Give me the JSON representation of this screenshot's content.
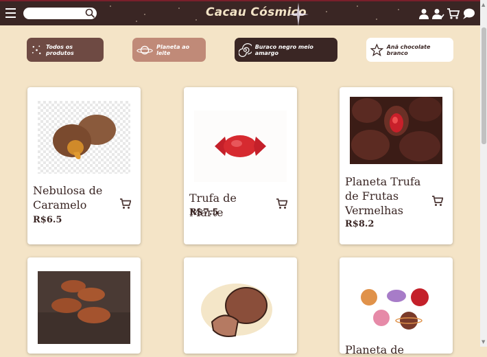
{
  "header": {
    "brand": "Cacau Cósmico",
    "search": {
      "placeholder": "",
      "value": ""
    }
  },
  "categories": [
    {
      "label": "Todos os produtos",
      "icon": "stars-icon",
      "bg": "#6e4a43",
      "fg": "#ffffff"
    },
    {
      "label": "Planeta ao leite",
      "icon": "planet-icon",
      "bg": "#c08a78",
      "fg": "#ffffff"
    },
    {
      "label": "Buraco negro meio amargo",
      "icon": "galaxy-icon",
      "bg": "#3a2624",
      "fg": "#ffffff"
    },
    {
      "label": "Anã chocolate branco",
      "icon": "star-outline-icon",
      "bg": "#ffffff",
      "fg": "#3a2624"
    }
  ],
  "products": [
    {
      "name": "Nebulosa de Caramelo",
      "price": "R$6.5",
      "image": "caramel-truffle"
    },
    {
      "name": "Trufa de Marte",
      "price": "R$7.5",
      "image": "red-wrapped-candy"
    },
    {
      "name": "Planeta Trufa de Frutas Vermelhas",
      "price": "R$8.2",
      "image": "red-fruit-bonbons"
    },
    {
      "name": "",
      "price": "",
      "image": "cocoa-dusted-almonds"
    },
    {
      "name": "",
      "price": "",
      "image": "chocolate-truffle-drawing"
    },
    {
      "name": "Planeta de",
      "price": "",
      "image": "planet-bonbons"
    }
  ],
  "colors": {
    "primary": "#3a2624",
    "background": "#f4e4c7",
    "accent": "#7a1f2b"
  }
}
